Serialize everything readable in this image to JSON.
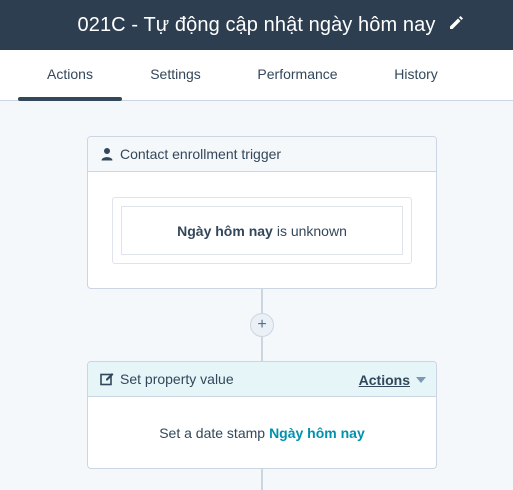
{
  "header": {
    "title": "021C - Tự động cập nhật ngày hôm nay",
    "edit_icon": "pencil-icon"
  },
  "tabs": [
    {
      "label": "Actions",
      "active": true
    },
    {
      "label": "Settings",
      "active": false
    },
    {
      "label": "Performance",
      "active": false
    },
    {
      "label": "History",
      "active": false
    }
  ],
  "trigger": {
    "icon": "person-icon",
    "title": "Contact enrollment trigger",
    "filter": {
      "property": "Ngày hôm nay",
      "condition": "is unknown"
    }
  },
  "add_button": {
    "label": "+"
  },
  "action": {
    "icon": "edit-square-icon",
    "title": "Set property value",
    "menu_label": "Actions",
    "body_prefix": "Set a date stamp",
    "body_property": "Ngày hôm nay"
  },
  "colors": {
    "header_bg": "#2d3e50",
    "accent_teal": "#0091ae",
    "border": "#cbd6e2",
    "action_head_bg": "#e5f5f8"
  }
}
